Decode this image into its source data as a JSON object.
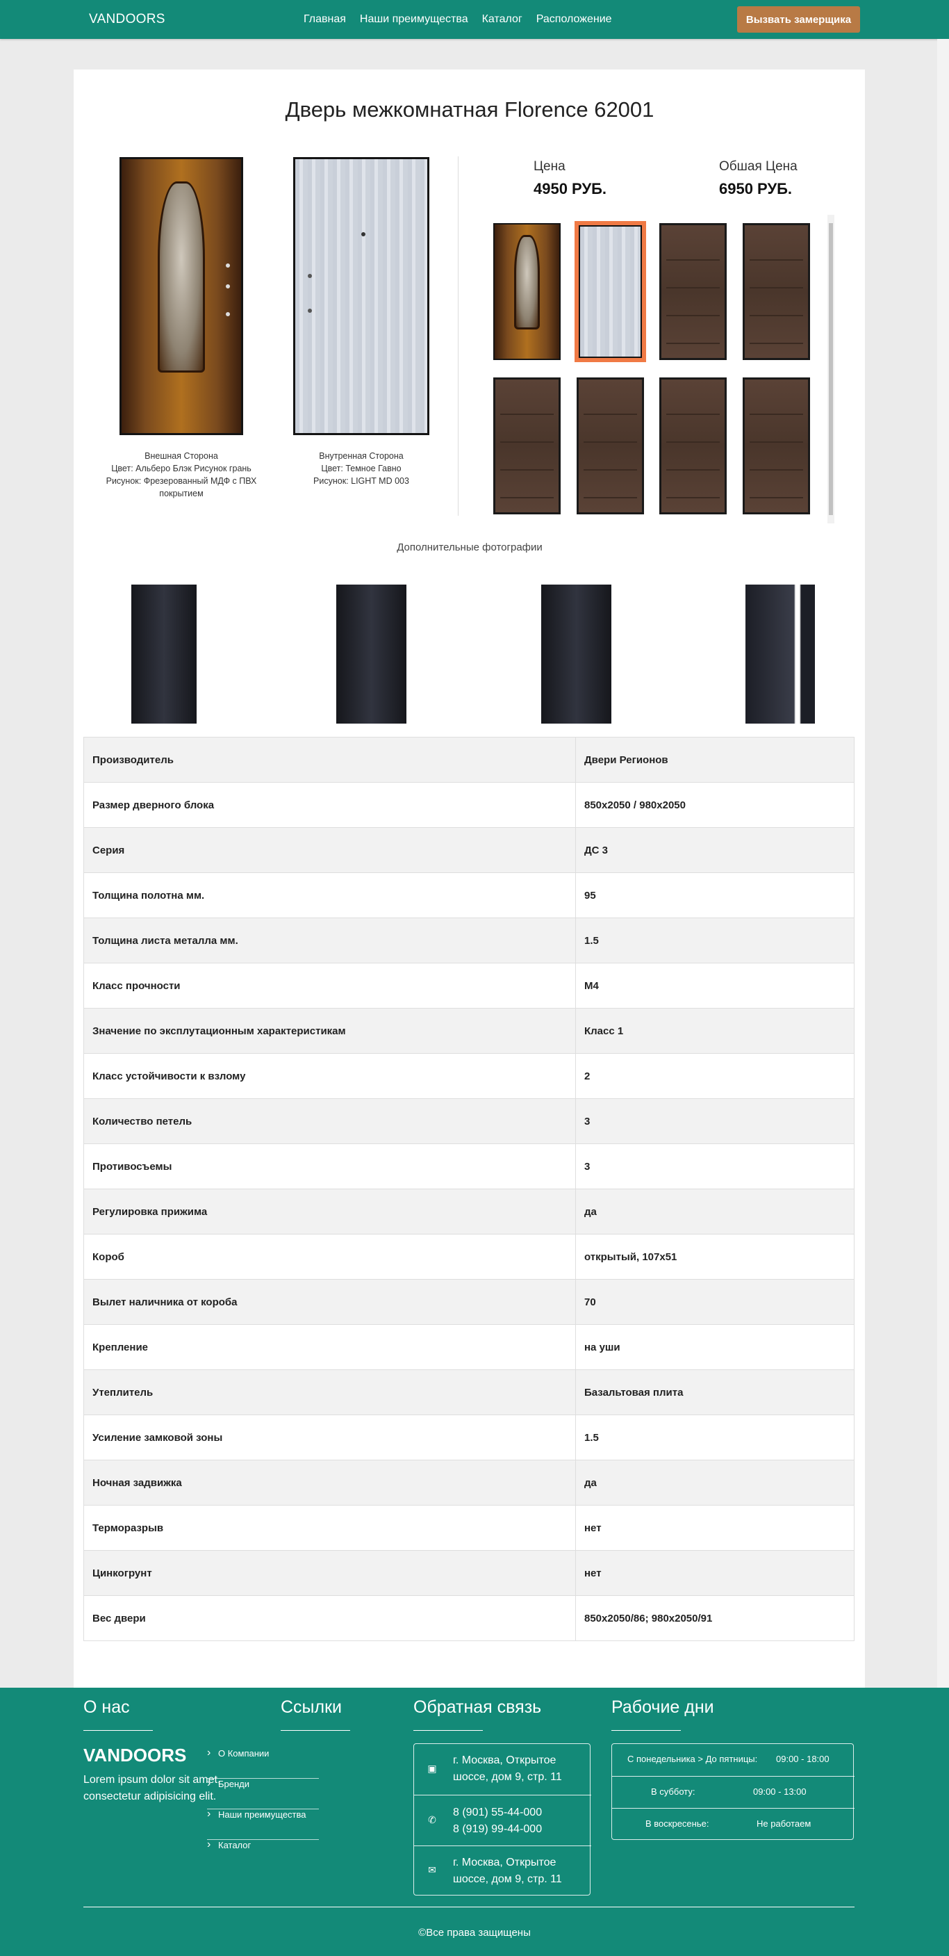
{
  "header": {
    "brand": "VANDOORS",
    "nav": [
      "Главная",
      "Наши преимущества",
      "Каталог",
      "Расположение"
    ],
    "cta": "Вызвать замерщика"
  },
  "product": {
    "title": "Дверь межкомнатная Florence 62001",
    "outer": {
      "line1": "Внешная Сторона",
      "line2": "Цвет: Альберо Блэк Рисунок грань",
      "line3": "Рисунок: Фрезерованный МДФ с ПВХ покрытием"
    },
    "inner": {
      "line1": "Внутренная Сторона",
      "line2": "Цвет: Темное Гавно",
      "line3": "Рисунок: LIGHT MD 003"
    },
    "price_label": "Цена",
    "price": "4950 РУБ.",
    "total_label": "Обшая Цена",
    "total": "6950 РУБ.",
    "extra_photos_label": "Дополнительные фотографии"
  },
  "specs": [
    [
      "Производитель",
      "Двери Регионов"
    ],
    [
      "Размер дверного блока",
      "850х2050 / 980х2050"
    ],
    [
      "Серия",
      "ДС 3"
    ],
    [
      "Толщина полотна мм.",
      "95"
    ],
    [
      "Толщина листа металла мм.",
      "1.5"
    ],
    [
      "Класс прочности",
      "М4"
    ],
    [
      "Значение по эксплутационным характеристикам",
      "Класс 1"
    ],
    [
      "Класс устойчивости к взлому",
      "2"
    ],
    [
      "Количество петель",
      "3"
    ],
    [
      "Противосъемы",
      "3"
    ],
    [
      "Регулировка прижима",
      "да"
    ],
    [
      "Короб",
      "открытый, 107х51"
    ],
    [
      "Вылет наличника от короба",
      "70"
    ],
    [
      "Крепление",
      "на уши"
    ],
    [
      "Утеплитель",
      "Базальтовая плита"
    ],
    [
      "Усиление замковой зоны",
      "1.5"
    ],
    [
      "Ночная задвижка",
      "да"
    ],
    [
      "Терморазрыв",
      "нет"
    ],
    [
      "Цинкогрунт",
      "нет"
    ],
    [
      "Вес двери",
      "850х2050/86; 980х2050/91"
    ]
  ],
  "footer": {
    "about_title": "О нас",
    "brand": "VANDOORS",
    "about_text": "Lorem ipsum dolor sit amet, consectetur adipisicing elit.",
    "links_title": "Ссылки",
    "links": [
      "О Компании",
      "Бренди",
      "Наши преимущества",
      "Каталог"
    ],
    "contact_title": "Обратная связь",
    "address": "г. Москва, Открытое шоссе, дом 9, стр. 11",
    "phone1": "8 (901) 55-44-000",
    "phone2": "8 (919) 99-44-000",
    "address2": "г. Москва, Открытое шоссе, дом 9, стр. 11",
    "hours_title": "Рабочие дни",
    "hours": [
      [
        "С понедельника > До пятницы:",
        "09:00 - 18:00"
      ],
      [
        "В субботу:",
        "09:00 - 13:00"
      ],
      [
        "В воскресенье:",
        "Не работаем"
      ]
    ],
    "copyright": "©Все права защищены"
  },
  "colors": {
    "primary": "#138a78",
    "accent": "#b87a45",
    "selected": "#f07a45"
  }
}
